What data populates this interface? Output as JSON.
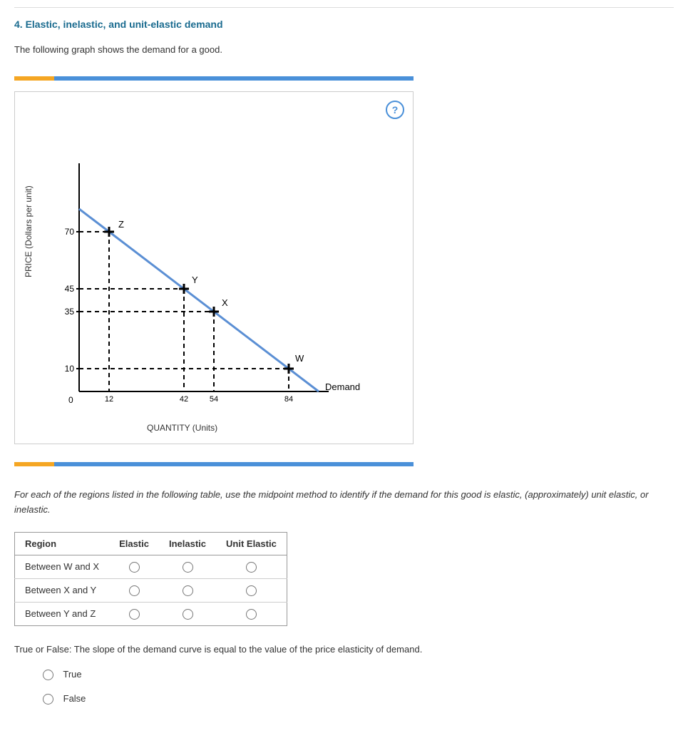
{
  "title": "4. Elastic, inelastic, and unit-elastic demand",
  "intro": "The following graph shows the demand for a good.",
  "help_icon": "?",
  "chart_data": {
    "type": "line",
    "xlabel": "QUANTITY (Units)",
    "ylabel": "PRICE (Dollars per unit)",
    "x_ticks": [
      0,
      12,
      42,
      54,
      84
    ],
    "y_ticks": [
      10,
      35,
      45,
      70
    ],
    "origin_label": "0",
    "demand_label": "Demand",
    "points": [
      {
        "label": "Z",
        "x": 12,
        "y": 70
      },
      {
        "label": "Y",
        "x": 42,
        "y": 45
      },
      {
        "label": "X",
        "x": 54,
        "y": 35
      },
      {
        "label": "W",
        "x": 84,
        "y": 10
      }
    ],
    "line_endpoints": [
      {
        "x": 0,
        "y": 80
      },
      {
        "x": 96,
        "y": 0
      }
    ],
    "x_max_visible": 100,
    "y_max_visible": 100
  },
  "instruction": "For each of the regions listed in the following table, use the midpoint method to identify if the demand for this good is elastic, (approximately) unit elastic, or inelastic.",
  "table": {
    "headers": [
      "Region",
      "Elastic",
      "Inelastic",
      "Unit Elastic"
    ],
    "rows": [
      {
        "region": "Between W and X"
      },
      {
        "region": "Between X and Y"
      },
      {
        "region": "Between Y and Z"
      }
    ]
  },
  "tf": {
    "question": "True or False: The slope of the demand curve is equal to the value of the price elasticity of demand.",
    "true_label": "True",
    "false_label": "False"
  }
}
